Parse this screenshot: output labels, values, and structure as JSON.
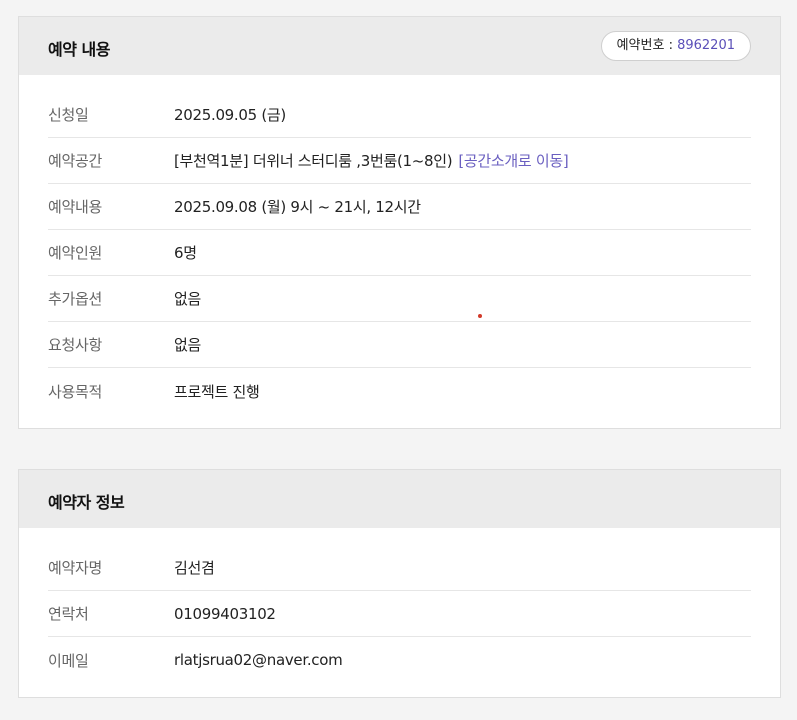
{
  "reservation": {
    "title": "예약 내용",
    "number_label": "예약번호 : ",
    "number_value": "8962201",
    "rows": [
      {
        "label": "신청일",
        "value": "2025.09.05 (금)"
      },
      {
        "label": "예약공간",
        "value": "[부천역1분] 더위너 스터디룸 ,3번룸(1~8인)",
        "link": "[공간소개로 이동]"
      },
      {
        "label": "예약내용",
        "value": "2025.09.08 (월) 9시 ~ 21시,  12시간"
      },
      {
        "label": "예약인원",
        "value": "6명"
      },
      {
        "label": "추가옵션",
        "value": "없음"
      },
      {
        "label": "요청사항",
        "value": "없음"
      },
      {
        "label": "사용목적",
        "value": "프로젝트 진행"
      }
    ]
  },
  "booker": {
    "title": "예약자 정보",
    "rows": [
      {
        "label": "예약자명",
        "value": "김선겸"
      },
      {
        "label": "연락처",
        "value": "01099403102"
      },
      {
        "label": "이메일",
        "value": "rlatjsrua02@naver.com"
      }
    ]
  },
  "colors": {
    "accent": "#5a4fb8",
    "header_bg": "#ebebeb",
    "page_bg": "#f4f4f4"
  }
}
